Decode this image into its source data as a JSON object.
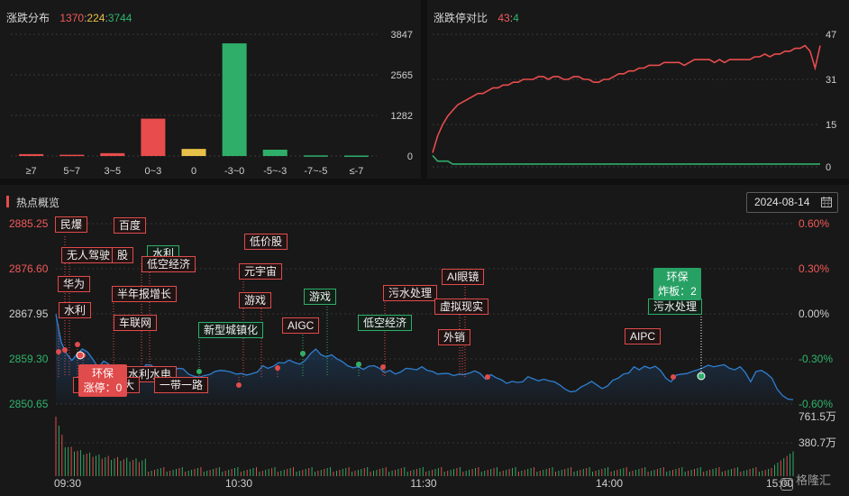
{
  "distribution": {
    "title": "涨跌分布",
    "up_count": "1370",
    "flat_count": "224",
    "down_count": "3744",
    "sep1": ":",
    "sep2": ":",
    "y_ticks": [
      "3847",
      "2565",
      "1282",
      "0"
    ]
  },
  "ratio": {
    "title": "涨跌停对比",
    "limit_up": "43",
    "sep": ":",
    "limit_down": "4",
    "y_ticks": [
      "47",
      "31",
      "15",
      "0"
    ]
  },
  "hot": {
    "title": "热点概览",
    "date": "2024-08-14",
    "left_ticks": [
      "2885.25",
      "2876.60",
      "2867.95",
      "2859.30",
      "2850.65"
    ],
    "right_ticks": [
      "0.60%",
      "0.30%",
      "0.00%",
      "-0.30%",
      "-0.60%"
    ],
    "vol_ticks": [
      "761.5万",
      "380.7万"
    ],
    "time_ticks": [
      "09:30",
      "10:30",
      "11:30",
      "14:00",
      "15:00"
    ]
  },
  "tags": [
    {
      "text": "民爆",
      "color": "r"
    },
    {
      "text": "百度",
      "color": "r"
    },
    {
      "text": "无人驾驶",
      "color": "r"
    },
    {
      "text": "股",
      "color": "r"
    },
    {
      "text": "水利",
      "color": "g"
    },
    {
      "text": "低空经济",
      "color": "r"
    },
    {
      "text": "低价股",
      "color": "r"
    },
    {
      "text": "华为",
      "color": "r"
    },
    {
      "text": "元宇宙",
      "color": "r"
    },
    {
      "text": "半年报增长",
      "color": "r"
    },
    {
      "text": "水利",
      "color": "r"
    },
    {
      "text": "游戏",
      "color": "r"
    },
    {
      "text": "游戏",
      "color": "g"
    },
    {
      "text": "污水处理",
      "color": "r"
    },
    {
      "text": "AI眼镜",
      "color": "r"
    },
    {
      "text": "车联网",
      "color": "r"
    },
    {
      "text": "新型城镇化",
      "color": "g"
    },
    {
      "text": "AIGC",
      "color": "r"
    },
    {
      "text": "低空经济",
      "color": "g"
    },
    {
      "text": "虚拟现实",
      "color": "r"
    },
    {
      "text": "外销",
      "color": "r"
    },
    {
      "text": "AIPC",
      "color": "r"
    },
    {
      "text": "污水处理",
      "color": "g"
    },
    {
      "text": "水利水电",
      "color": "r"
    },
    {
      "text": "一带一路",
      "color": "r"
    },
    {
      "text": "荣",
      "color": "r"
    },
    {
      "text": "大",
      "color": "r"
    }
  ],
  "callouts": {
    "red": {
      "line1": "环保",
      "line2": "涨停：0"
    },
    "green": {
      "line1": "环保",
      "line2": "炸板：2"
    }
  },
  "watermark": "格隆汇",
  "colors": {
    "up": "#e84c4c",
    "down": "#2fae6a",
    "flat": "#e8c14a",
    "index_line": "#2f7fd0"
  },
  "chart_data": [
    {
      "type": "bar",
      "title": "涨跌分布",
      "categories": [
        "≥7",
        "5~7",
        "3~5",
        "0~3",
        "0",
        "-3~0",
        "-5~-3",
        "-7~-5",
        "≤-7"
      ],
      "values": [
        60,
        40,
        90,
        1180,
        224,
        3560,
        200,
        20,
        15
      ],
      "ylim": [
        0,
        3847
      ]
    },
    {
      "type": "line",
      "title": "涨跌停对比",
      "ylim": [
        0,
        47
      ],
      "series": [
        {
          "name": "涨停",
          "values": [
            5,
            11,
            15,
            18,
            20,
            22,
            23,
            24,
            25,
            26,
            26,
            27,
            28,
            28,
            29,
            29,
            30,
            30,
            31,
            31,
            31,
            32,
            32,
            31,
            32,
            32,
            31,
            31,
            32,
            32,
            31,
            31,
            30,
            30,
            31,
            31,
            32,
            33,
            33,
            34,
            34,
            35,
            35,
            36,
            36,
            36,
            37,
            37,
            37,
            37,
            36,
            37,
            38,
            38,
            38,
            38,
            37,
            38,
            37,
            38,
            38,
            38,
            38,
            38,
            39,
            39,
            40,
            39,
            40,
            40,
            41,
            41,
            42,
            42,
            43,
            41,
            35,
            43
          ]
        },
        {
          "name": "跌停",
          "values": [
            4,
            2,
            2,
            2,
            1,
            1,
            1,
            1,
            1,
            1,
            1,
            1,
            1,
            1,
            1,
            1,
            1,
            1,
            1,
            1,
            1,
            1,
            1,
            1,
            1,
            1,
            1,
            1,
            1,
            1,
            1,
            1,
            1,
            1,
            1,
            1,
            1,
            1,
            1,
            1,
            1,
            1,
            1,
            1,
            1,
            1,
            1,
            1,
            1,
            1,
            1,
            1,
            1,
            1,
            1,
            1,
            1,
            1,
            1,
            1,
            1,
            1,
            1,
            1,
            1,
            1,
            1,
            1,
            1,
            1,
            1,
            1,
            1,
            1,
            1,
            1,
            1,
            1
          ]
        }
      ]
    },
    {
      "type": "area",
      "title": "热点概览",
      "ylim": [
        2850.65,
        2885.25
      ],
      "y_pct_range": [
        -0.6,
        0.6
      ],
      "values": [
        2867.9,
        2862.5,
        2860.3,
        2859.0,
        2860.2,
        2861.2,
        2860.6,
        2859.2,
        2857.6,
        2858.9,
        2858.3,
        2856.3,
        2856.2,
        2856.6,
        2856.1,
        2855.9,
        2856.6,
        2858.2,
        2858.1,
        2857.0,
        2857.3,
        2857.5,
        2856.9,
        2857.5,
        2857.4,
        2856.4,
        2856.0,
        2855.8,
        2856.1,
        2856.3,
        2856.9,
        2857.1,
        2857.0,
        2856.8,
        2856.4,
        2856.5,
        2856.2,
        2856.5,
        2856.8,
        2858.0,
        2857.5,
        2857.9,
        2858.6,
        2858.5,
        2859.1,
        2858.6,
        2858.3,
        2859.0,
        2860.3,
        2861.2,
        2860.1,
        2859.7,
        2860.1,
        2859.3,
        2858.8,
        2858.0,
        2857.6,
        2857.8,
        2857.3,
        2857.9,
        2858.0,
        2857.5,
        2856.7,
        2857.1,
        2856.4,
        2856.8,
        2857.5,
        2857.4,
        2857.2,
        2857.8,
        2857.1,
        2856.9,
        2856.4,
        2856.5,
        2856.5,
        2856.1,
        2856.4,
        2856.3,
        2856.6,
        2857.0,
        2856.5,
        2855.4,
        2856.3,
        2855.7,
        2855.3,
        2854.6,
        2855.0,
        2854.8,
        2854.9,
        2855.9,
        2855.5,
        2855.1,
        2855.4,
        2855.1,
        2854.9,
        2854.3,
        2853.5,
        2853.0,
        2853.1,
        2853.9,
        2854.4,
        2855.0,
        2854.3,
        2853.6,
        2854.1,
        2855.2,
        2855.6,
        2856.4,
        2856.6,
        2857.8,
        2857.2,
        2857.9,
        2857.5,
        2857.9,
        2857.1,
        2855.6,
        2854.9,
        2856.2,
        2856.4,
        2856.5,
        2856.9,
        2857.2,
        2857.6,
        2858.1,
        2857.8,
        2858.0,
        2858.2,
        2857.5,
        2857.2,
        2857.8,
        2856.7,
        2854.9,
        2856.9,
        2857.1,
        2856.5,
        2855.6,
        2853.5,
        2852.3,
        2851.6,
        2851.5
      ]
    }
  ]
}
